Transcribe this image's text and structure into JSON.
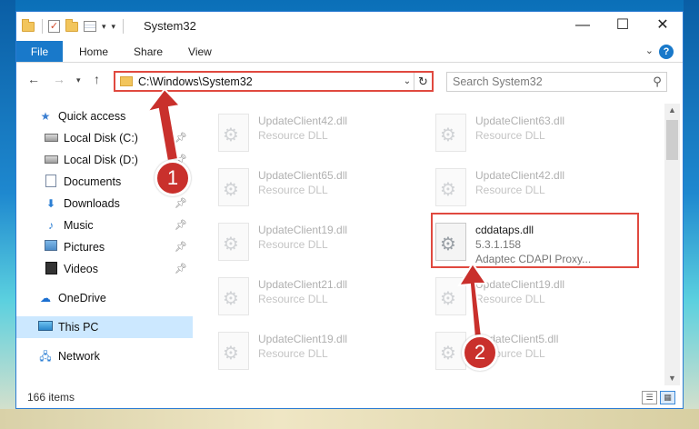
{
  "window": {
    "title": "System32",
    "quick_access_toolbar_dropdown": "▾"
  },
  "ribbon": {
    "tabs": [
      "File",
      "Home",
      "Share",
      "View"
    ],
    "help": "?"
  },
  "address_bar": {
    "path": "C:\\Windows\\System32",
    "search_placeholder": "Search System32"
  },
  "nav_pane": {
    "quick_access": "Quick access",
    "items": [
      {
        "label": "Local Disk (C:)",
        "icon": "drive-icon",
        "pinned": true
      },
      {
        "label": "Local Disk (D:)",
        "icon": "drive-icon",
        "pinned": true
      },
      {
        "label": "Documents",
        "icon": "documents-icon",
        "pinned": true
      },
      {
        "label": "Downloads",
        "icon": "downloads-icon",
        "pinned": true
      },
      {
        "label": "Music",
        "icon": "music-icon",
        "pinned": true
      },
      {
        "label": "Pictures",
        "icon": "pictures-icon",
        "pinned": true
      },
      {
        "label": "Videos",
        "icon": "videos-icon",
        "pinned": true
      }
    ],
    "onedrive": "OneDrive",
    "this_pc": "This PC",
    "network": "Network"
  },
  "files": [
    {
      "name": "UpdateClient42.dll",
      "desc": "Resource DLL"
    },
    {
      "name": "UpdateClient63.dll",
      "desc": "Resource DLL"
    },
    {
      "name": "UpdateClient65.dll",
      "desc": "Resource DLL"
    },
    {
      "name": "UpdateClient42.dll",
      "desc": "Resource DLL"
    },
    {
      "name": "UpdateClient19.dll",
      "desc": "Resource DLL"
    },
    {
      "name": "cddataps.dll",
      "version": "5.3.1.158",
      "desc": "Adaptec CDAPI Proxy..."
    },
    {
      "name": "UpdateClient21.dll",
      "desc": "Resource DLL"
    },
    {
      "name": "UpdateClient19.dll",
      "desc": "Resource DLL"
    },
    {
      "name": "UpdateClient19.dll",
      "desc": "Resource DLL"
    },
    {
      "name": "UpdateClient5.dll",
      "desc": "Resource DLL"
    }
  ],
  "status": {
    "item_count": "166 items"
  },
  "annotations": {
    "step1": "1",
    "step2": "2"
  },
  "colors": {
    "highlight": "#e0493f",
    "callout": "#c9302c",
    "accent": "#1979ca"
  }
}
